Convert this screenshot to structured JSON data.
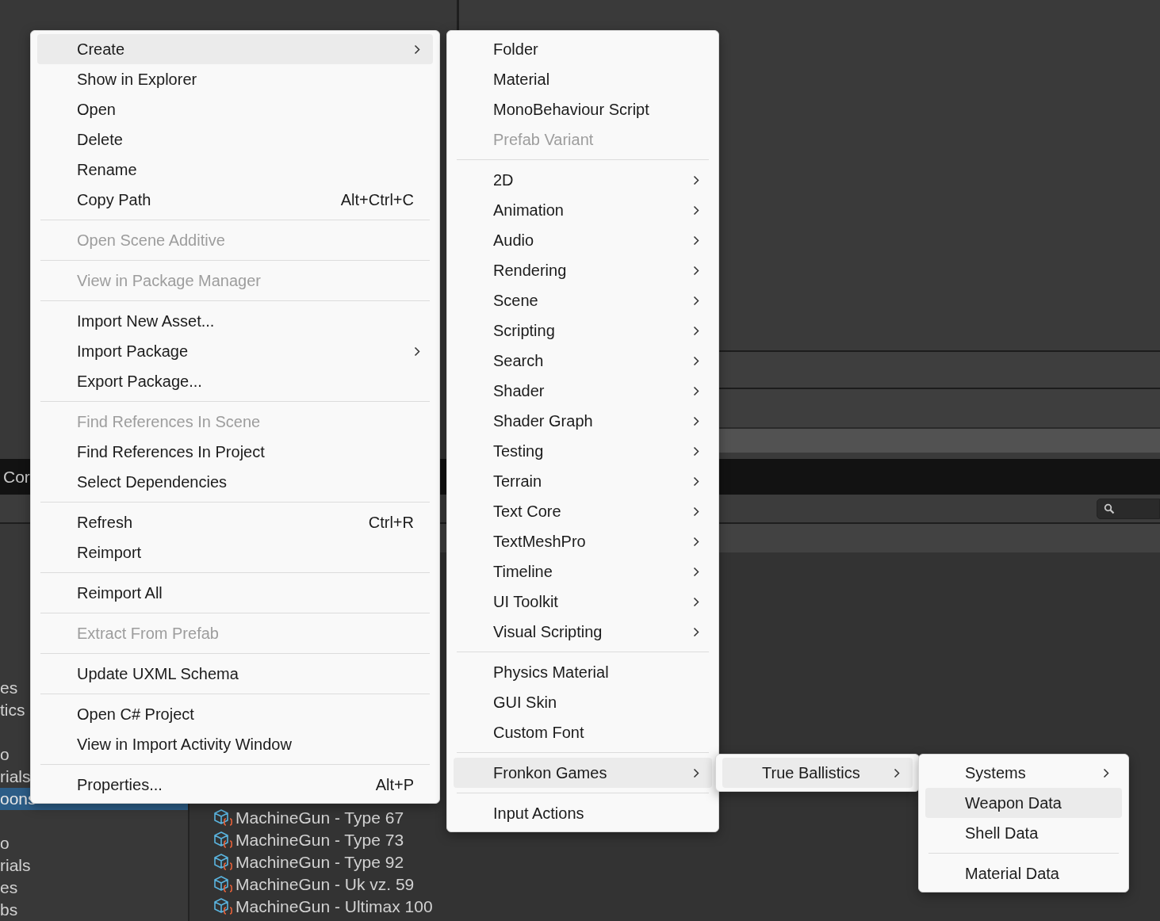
{
  "editor": {
    "tab_label": "Cor",
    "sidebar": {
      "groups": [
        [
          {
            "label": "es",
            "selected": false
          },
          {
            "label": "tics",
            "selected": false
          }
        ],
        [
          {
            "label": "o",
            "selected": false
          },
          {
            "label": "rials",
            "selected": false
          },
          {
            "label": "oons",
            "selected": true
          }
        ],
        [
          {
            "label": "o",
            "selected": false
          },
          {
            "label": "rials",
            "selected": false
          },
          {
            "label": "es",
            "selected": false
          },
          {
            "label": "bs",
            "selected": false
          }
        ]
      ]
    },
    "assets": [
      {
        "label": "MachineGun - Type 67"
      },
      {
        "label": "MachineGun - Type 73"
      },
      {
        "label": "MachineGun - Type 92"
      },
      {
        "label": "MachineGun - Uk vz. 59"
      },
      {
        "label": "MachineGun - Ultimax 100"
      }
    ]
  },
  "menus": [
    {
      "sections": [
        [
          {
            "label": "Create",
            "submenu": true,
            "disabled": false,
            "selected": true
          },
          {
            "label": "Show in Explorer",
            "submenu": false,
            "disabled": false,
            "selected": false
          },
          {
            "label": "Open",
            "submenu": false,
            "disabled": false,
            "selected": false
          },
          {
            "label": "Delete",
            "submenu": false,
            "disabled": false,
            "selected": false
          },
          {
            "label": "Rename",
            "submenu": false,
            "disabled": false,
            "selected": false
          },
          {
            "label": "Copy Path",
            "shortcut": "Alt+Ctrl+C",
            "submenu": false,
            "disabled": false,
            "selected": false
          }
        ],
        [
          {
            "label": "Open Scene Additive",
            "submenu": false,
            "disabled": true,
            "selected": false
          }
        ],
        [
          {
            "label": "View in Package Manager",
            "submenu": false,
            "disabled": true,
            "selected": false
          }
        ],
        [
          {
            "label": "Import New Asset...",
            "submenu": false,
            "disabled": false,
            "selected": false
          },
          {
            "label": "Import Package",
            "submenu": true,
            "disabled": false,
            "selected": false
          },
          {
            "label": "Export Package...",
            "submenu": false,
            "disabled": false,
            "selected": false
          }
        ],
        [
          {
            "label": "Find References In Scene",
            "submenu": false,
            "disabled": true,
            "selected": false
          },
          {
            "label": "Find References In Project",
            "submenu": false,
            "disabled": false,
            "selected": false
          },
          {
            "label": "Select Dependencies",
            "submenu": false,
            "disabled": false,
            "selected": false
          }
        ],
        [
          {
            "label": "Refresh",
            "shortcut": "Ctrl+R",
            "submenu": false,
            "disabled": false,
            "selected": false
          },
          {
            "label": "Reimport",
            "submenu": false,
            "disabled": false,
            "selected": false
          }
        ],
        [
          {
            "label": "Reimport All",
            "submenu": false,
            "disabled": false,
            "selected": false
          }
        ],
        [
          {
            "label": "Extract From Prefab",
            "submenu": false,
            "disabled": true,
            "selected": false
          }
        ],
        [
          {
            "label": "Update UXML Schema",
            "submenu": false,
            "disabled": false,
            "selected": false
          }
        ],
        [
          {
            "label": "Open C# Project",
            "submenu": false,
            "disabled": false,
            "selected": false
          },
          {
            "label": "View in Import Activity Window",
            "submenu": false,
            "disabled": false,
            "selected": false
          }
        ],
        [
          {
            "label": "Properties...",
            "shortcut": "Alt+P",
            "submenu": false,
            "disabled": false,
            "selected": false
          }
        ]
      ]
    },
    {
      "sections": [
        [
          {
            "label": "Folder",
            "submenu": false,
            "disabled": false,
            "selected": false
          },
          {
            "label": "Material",
            "submenu": false,
            "disabled": false,
            "selected": false
          },
          {
            "label": "MonoBehaviour Script",
            "submenu": false,
            "disabled": false,
            "selected": false
          },
          {
            "label": "Prefab Variant",
            "submenu": false,
            "disabled": true,
            "selected": false
          }
        ],
        [
          {
            "label": "2D",
            "submenu": true,
            "disabled": false,
            "selected": false
          },
          {
            "label": "Animation",
            "submenu": true,
            "disabled": false,
            "selected": false
          },
          {
            "label": "Audio",
            "submenu": true,
            "disabled": false,
            "selected": false
          },
          {
            "label": "Rendering",
            "submenu": true,
            "disabled": false,
            "selected": false
          },
          {
            "label": "Scene",
            "submenu": true,
            "disabled": false,
            "selected": false
          },
          {
            "label": "Scripting",
            "submenu": true,
            "disabled": false,
            "selected": false
          },
          {
            "label": "Search",
            "submenu": true,
            "disabled": false,
            "selected": false
          },
          {
            "label": "Shader",
            "submenu": true,
            "disabled": false,
            "selected": false
          },
          {
            "label": "Shader Graph",
            "submenu": true,
            "disabled": false,
            "selected": false
          },
          {
            "label": "Testing",
            "submenu": true,
            "disabled": false,
            "selected": false
          },
          {
            "label": "Terrain",
            "submenu": true,
            "disabled": false,
            "selected": false
          },
          {
            "label": "Text Core",
            "submenu": true,
            "disabled": false,
            "selected": false
          },
          {
            "label": "TextMeshPro",
            "submenu": true,
            "disabled": false,
            "selected": false
          },
          {
            "label": "Timeline",
            "submenu": true,
            "disabled": false,
            "selected": false
          },
          {
            "label": "UI Toolkit",
            "submenu": true,
            "disabled": false,
            "selected": false
          },
          {
            "label": "Visual Scripting",
            "submenu": true,
            "disabled": false,
            "selected": false
          }
        ],
        [
          {
            "label": "Physics Material",
            "submenu": false,
            "disabled": false,
            "selected": false
          },
          {
            "label": "GUI Skin",
            "submenu": false,
            "disabled": false,
            "selected": false
          },
          {
            "label": "Custom Font",
            "submenu": false,
            "disabled": false,
            "selected": false
          }
        ],
        [
          {
            "label": "Fronkon Games",
            "submenu": true,
            "disabled": false,
            "selected": true
          }
        ],
        [
          {
            "label": "Input Actions",
            "submenu": false,
            "disabled": false,
            "selected": false
          }
        ]
      ]
    },
    {
      "sections": [
        [
          {
            "label": "True Ballistics",
            "submenu": true,
            "disabled": false,
            "selected": true
          }
        ]
      ]
    },
    {
      "sections": [
        [
          {
            "label": "Systems",
            "submenu": true,
            "disabled": false,
            "selected": false
          },
          {
            "label": "Weapon Data",
            "submenu": false,
            "disabled": false,
            "selected": true
          },
          {
            "label": "Shell Data",
            "submenu": false,
            "disabled": false,
            "selected": false
          }
        ],
        [
          {
            "label": "Material Data",
            "submenu": false,
            "disabled": false,
            "selected": false
          }
        ]
      ]
    }
  ]
}
